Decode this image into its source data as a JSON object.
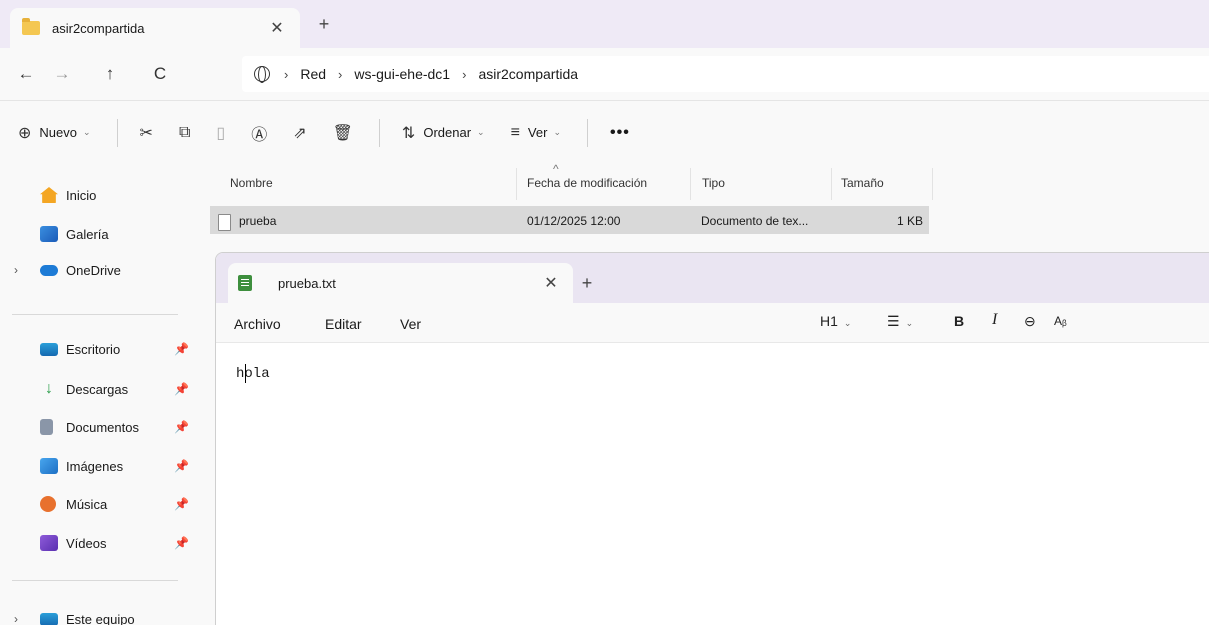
{
  "explorer": {
    "tab_title": "asir2compartida",
    "tab_close": "✕",
    "new_tab": "+",
    "nav": {
      "back": "←",
      "forward": "→",
      "up": "↑",
      "refresh": "C"
    },
    "breadcrumbs": [
      "Red",
      "ws-gui-ehe-dc1",
      "asir2compartida"
    ],
    "breadcrumb_separator": "›",
    "commands": {
      "new_label": "Nuevo",
      "sort_label": "Ordenar",
      "view_label": "Ver",
      "more": "•••"
    },
    "sidebar": {
      "home": "Inicio",
      "gallery": "Galería",
      "onedrive": "OneDrive",
      "desktop": "Escritorio",
      "downloads": "Descargas",
      "documents": "Documentos",
      "pictures": "Imágenes",
      "music": "Música",
      "videos": "Vídeos",
      "this_pc": "Este equipo"
    },
    "columns": {
      "name": "Nombre",
      "modified": "Fecha de modificación",
      "type": "Tipo",
      "size": "Tamaño"
    },
    "files": [
      {
        "name": "prueba",
        "modified": "01/12/2025 12:00",
        "type": "Documento de tex...",
        "size": "1 KB"
      }
    ]
  },
  "notepad": {
    "tab_title": "prueba.txt",
    "tab_close": "✕",
    "new_tab": "+",
    "menus": {
      "file": "Archivo",
      "edit": "Editar",
      "view": "Ver"
    },
    "format": {
      "heading": "H1",
      "bold": "B",
      "italic": "I"
    },
    "content": "hola"
  },
  "colors": {
    "titlebar_bg": "#efeaf6",
    "selected_row": "#d9d9d9",
    "notepad_icon": "#3e8f3e",
    "folder": "#f4c752"
  }
}
